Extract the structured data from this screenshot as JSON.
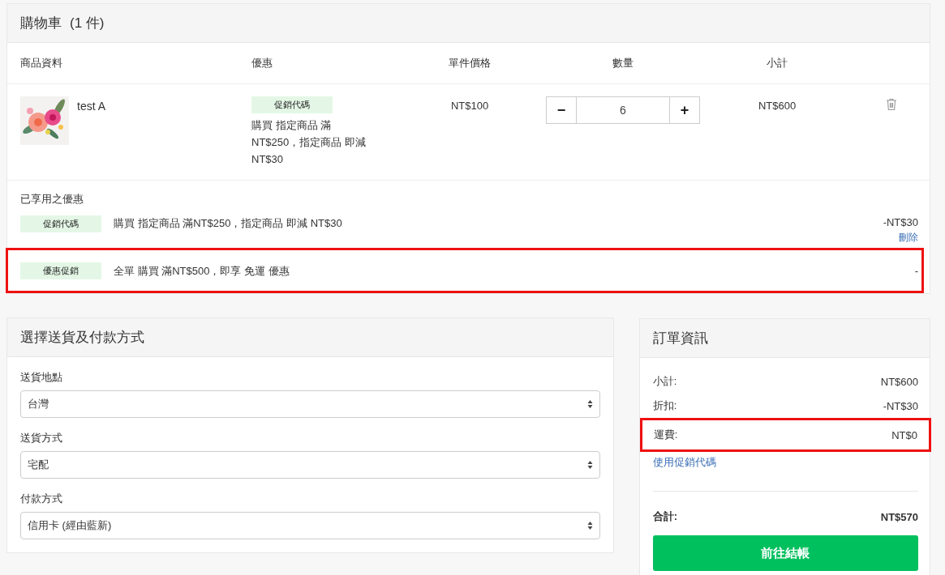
{
  "cart": {
    "title": "購物車",
    "count": "(1 件)",
    "columns": [
      "商品資料",
      "優惠",
      "單件價格",
      "數量",
      "小計"
    ],
    "items": [
      {
        "name": "test A",
        "promo_tag": "促銷代碼",
        "promo_text": "購買 指定商品 滿 NT$250，指定商品 即減 NT$30",
        "price": "NT$100",
        "decrement": "−",
        "quantity": "6",
        "increment": "+",
        "subtotal": "NT$600"
      }
    ],
    "applied_title": "已享用之優惠",
    "applied": [
      {
        "tag": "促銷代碼",
        "text": "購買 指定商品 滿NT$250，指定商品 即減 NT$30",
        "amount": "-NT$30",
        "remove": "刪除",
        "highlighted": false
      },
      {
        "tag": "優惠促銷",
        "text": "全單 購買 滿NT$500，即享 免運 優惠",
        "amount": "-",
        "highlighted": true
      }
    ]
  },
  "delivery": {
    "title": "選擇送貨及付款方式",
    "fields": [
      {
        "label": "送貨地點",
        "value": "台灣"
      },
      {
        "label": "送貨方式",
        "value": "宅配"
      },
      {
        "label": "付款方式",
        "value": "信用卡 (經由藍新)"
      }
    ]
  },
  "order": {
    "title": "訂單資訊",
    "rows": [
      {
        "label": "小計:",
        "value": "NT$600",
        "highlighted": false
      },
      {
        "label": "折扣:",
        "value": "-NT$30",
        "highlighted": false
      },
      {
        "label": "運費:",
        "value": "NT$0",
        "highlighted": true
      }
    ],
    "promo_link": "使用促銷代碼",
    "total_label": "合計:",
    "total_value": "NT$570",
    "checkout": "前往結帳"
  }
}
